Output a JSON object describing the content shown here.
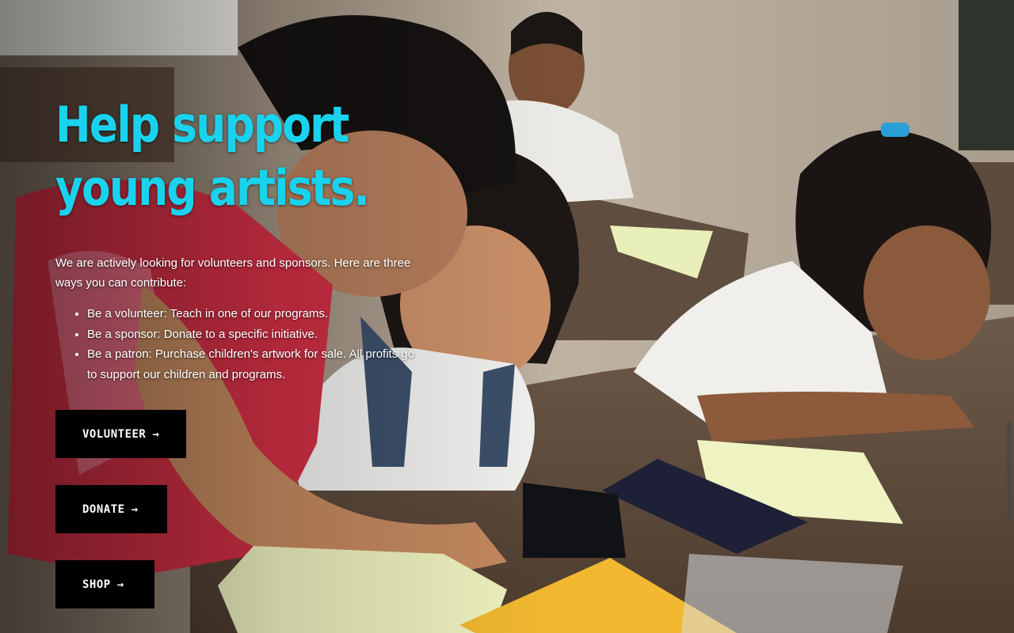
{
  "hero": {
    "headline": "Help support young artists.",
    "intro": "We are actively looking for volunteers and sponsors. Here are three ways you can contribute:",
    "ways": [
      "Be a volunteer:  Teach in one of our programs.",
      "Be a sponsor:  Donate to a specific initiative.",
      "Be a patron:  Purchase children's artwork for sale. All profits go to support our children and programs."
    ],
    "buttons": {
      "volunteer": "VOLUNTEER",
      "donate": "DONATE",
      "shop": "SHOP",
      "arrow": "→"
    }
  },
  "colors": {
    "headline": "#19d3ee",
    "button_bg": "#000000",
    "button_text": "#ffffff",
    "body_text": "#ffffff"
  },
  "scrollbar": {
    "position_fraction": 0.79
  }
}
